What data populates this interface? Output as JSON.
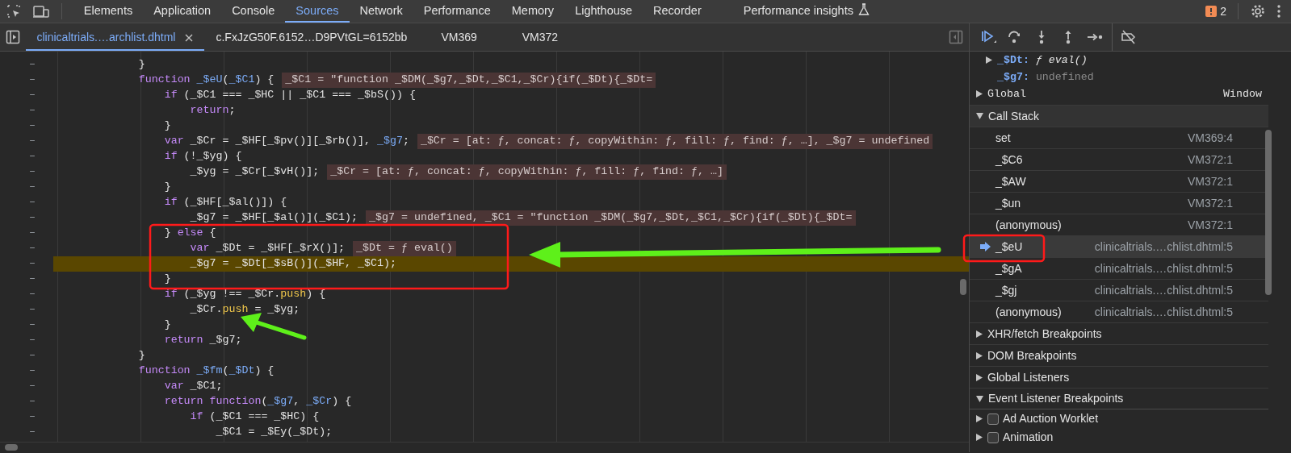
{
  "main_tabs": [
    {
      "label": "Elements",
      "selected": false
    },
    {
      "label": "Application",
      "selected": false
    },
    {
      "label": "Console",
      "selected": false
    },
    {
      "label": "Sources",
      "selected": true
    },
    {
      "label": "Network",
      "selected": false
    },
    {
      "label": "Performance",
      "selected": false
    },
    {
      "label": "Memory",
      "selected": false
    },
    {
      "label": "Lighthouse",
      "selected": false
    },
    {
      "label": "Recorder",
      "selected": false
    },
    {
      "label": "Performance insights",
      "selected": false,
      "experimental": true
    }
  ],
  "issues_count": "2",
  "file_tabs": [
    {
      "label": "clinicaltrials.…archlist.dhtml",
      "selected": true,
      "closable": true
    },
    {
      "label": "c.FxJzG50F.6152…D9PVtGL=6152bb",
      "selected": false,
      "closable": false
    },
    {
      "label": "VM369",
      "selected": false,
      "closable": false
    },
    {
      "label": "VM372",
      "selected": false,
      "closable": false
    }
  ],
  "code_lines": [
    {
      "gutter": "–",
      "paused": false,
      "tokens": [
        {
          "kind": "plain",
          "text": "            }"
        }
      ]
    },
    {
      "gutter": "–",
      "paused": false,
      "tokens": [
        {
          "kind": "keyword",
          "text": "            function "
        },
        {
          "kind": "definition",
          "text": "_$eU"
        },
        {
          "kind": "plain",
          "text": "("
        },
        {
          "kind": "definition",
          "text": "_$C1"
        },
        {
          "kind": "plain",
          "text": ") {"
        }
      ],
      "value": "_$C1 = \"function _$DM(_$g7,_$Dt,_$C1,_$Cr){if(_$Dt){_$Dt="
    },
    {
      "gutter": "–",
      "paused": false,
      "tokens": [
        {
          "kind": "keyword",
          "text": "                if"
        },
        {
          "kind": "plain",
          "text": " (_$C1 === _$HC || _$C1 === _$bS()) {"
        }
      ]
    },
    {
      "gutter": "–",
      "paused": false,
      "tokens": [
        {
          "kind": "keyword",
          "text": "                    return"
        },
        {
          "kind": "plain",
          "text": ";"
        }
      ]
    },
    {
      "gutter": "–",
      "paused": false,
      "tokens": [
        {
          "kind": "plain",
          "text": "                }"
        }
      ]
    },
    {
      "gutter": "–",
      "paused": false,
      "tokens": [
        {
          "kind": "keyword",
          "text": "                var "
        },
        {
          "kind": "plain",
          "text": "_$Cr = _$HF[_$pv()][_$rb()], "
        },
        {
          "kind": "definition",
          "text": "_$g7"
        },
        {
          "kind": "plain",
          "text": ";"
        }
      ],
      "value": "_$Cr = [at: ƒ, concat: ƒ, copyWithin: ƒ, fill: ƒ, find: ƒ, …], _$g7 = undefined"
    },
    {
      "gutter": "–",
      "paused": false,
      "tokens": [
        {
          "kind": "keyword",
          "text": "                if"
        },
        {
          "kind": "plain",
          "text": " (!_$yg) {"
        }
      ]
    },
    {
      "gutter": "–",
      "paused": false,
      "tokens": [
        {
          "kind": "plain",
          "text": "                    _$yg = _$Cr[_$vH()];"
        }
      ],
      "value": "_$Cr = [at: ƒ, concat: ƒ, copyWithin: ƒ, fill: ƒ, find: ƒ, …]"
    },
    {
      "gutter": "–",
      "paused": false,
      "tokens": [
        {
          "kind": "plain",
          "text": "                }"
        }
      ]
    },
    {
      "gutter": "–",
      "paused": false,
      "tokens": [
        {
          "kind": "keyword",
          "text": "                if"
        },
        {
          "kind": "plain",
          "text": " (_$HF[_$al()]) {"
        }
      ]
    },
    {
      "gutter": "–",
      "paused": false,
      "tokens": [
        {
          "kind": "plain",
          "text": "                    _$g7 = _$HF[_$al()](_$C1);"
        }
      ],
      "value": "_$g7 = undefined, _$C1 = \"function _$DM(_$g7,_$Dt,_$C1,_$Cr){if(_$Dt){_$Dt="
    },
    {
      "gutter": "–",
      "paused": false,
      "tokens": [
        {
          "kind": "plain",
          "text": "                } "
        },
        {
          "kind": "keyword",
          "text": "else"
        },
        {
          "kind": "plain",
          "text": " {"
        }
      ]
    },
    {
      "gutter": "–",
      "paused": false,
      "tokens": [
        {
          "kind": "keyword",
          "text": "                    var "
        },
        {
          "kind": "plain",
          "text": "_$Dt = _$HF[_$rX()];"
        }
      ],
      "value": "_$Dt = ƒ eval()"
    },
    {
      "gutter": "–",
      "paused": true,
      "tokens": [
        {
          "kind": "plain",
          "text": "                    _$g7 = _$Dt[_$sB()](_$HF, _$C1);"
        }
      ]
    },
    {
      "gutter": "–",
      "paused": false,
      "tokens": [
        {
          "kind": "plain",
          "text": "                }"
        }
      ]
    },
    {
      "gutter": "–",
      "paused": false,
      "tokens": [
        {
          "kind": "keyword",
          "text": "                if"
        },
        {
          "kind": "plain",
          "text": " (_$yg !== _$Cr."
        },
        {
          "kind": "property",
          "text": "push"
        },
        {
          "kind": "plain",
          "text": ") {"
        }
      ]
    },
    {
      "gutter": "–",
      "paused": false,
      "tokens": [
        {
          "kind": "plain",
          "text": "                    _$Cr."
        },
        {
          "kind": "property",
          "text": "push"
        },
        {
          "kind": "plain",
          "text": " = _$yg;"
        }
      ]
    },
    {
      "gutter": "–",
      "paused": false,
      "tokens": [
        {
          "kind": "plain",
          "text": "                }"
        }
      ]
    },
    {
      "gutter": "–",
      "paused": false,
      "tokens": [
        {
          "kind": "keyword",
          "text": "                return"
        },
        {
          "kind": "plain",
          "text": " _$g7;"
        }
      ]
    },
    {
      "gutter": "–",
      "paused": false,
      "tokens": [
        {
          "kind": "plain",
          "text": "            }"
        }
      ]
    },
    {
      "gutter": "–",
      "paused": false,
      "tokens": [
        {
          "kind": "keyword",
          "text": "            function "
        },
        {
          "kind": "definition",
          "text": "_$fm"
        },
        {
          "kind": "plain",
          "text": "("
        },
        {
          "kind": "definition",
          "text": "_$Dt"
        },
        {
          "kind": "plain",
          "text": ") {"
        }
      ]
    },
    {
      "gutter": "–",
      "paused": false,
      "tokens": [
        {
          "kind": "keyword",
          "text": "                var "
        },
        {
          "kind": "plain",
          "text": "_$C1;"
        }
      ]
    },
    {
      "gutter": "–",
      "paused": false,
      "tokens": [
        {
          "kind": "keyword",
          "text": "                return function"
        },
        {
          "kind": "plain",
          "text": "("
        },
        {
          "kind": "definition",
          "text": "_$g7"
        },
        {
          "kind": "plain",
          "text": ", "
        },
        {
          "kind": "definition",
          "text": "_$Cr"
        },
        {
          "kind": "plain",
          "text": ") {"
        }
      ]
    },
    {
      "gutter": "–",
      "paused": false,
      "tokens": [
        {
          "kind": "keyword",
          "text": "                    if"
        },
        {
          "kind": "plain",
          "text": " (_$C1 === _$HC) {"
        }
      ]
    },
    {
      "gutter": "–",
      "paused": false,
      "tokens": [
        {
          "kind": "plain",
          "text": "                        _$C1 = _$Ey(_$Dt);"
        }
      ]
    }
  ],
  "scope_vars": [
    {
      "name": "_$Dt:",
      "value": "ƒ eval()",
      "kind": "function",
      "expandable": true
    },
    {
      "name": "_$g7:",
      "value": "undefined",
      "kind": "undefined",
      "expandable": false
    }
  ],
  "global_scope": {
    "label": "Global",
    "value": "Window",
    "expanded": false
  },
  "call_stack": {
    "label": "Call Stack",
    "expanded": true,
    "frames": [
      {
        "name": "set",
        "location": "VM369:4",
        "selected": false
      },
      {
        "name": "_$C6",
        "location": "VM372:1",
        "selected": false
      },
      {
        "name": "_$AW",
        "location": "VM372:1",
        "selected": false
      },
      {
        "name": "_$un",
        "location": "VM372:1",
        "selected": false
      },
      {
        "name": "(anonymous)",
        "location": "VM372:1",
        "selected": false
      },
      {
        "name": "_$eU",
        "location": "clinicaltrials.…chlist.dhtml:5",
        "selected": true
      },
      {
        "name": "_$gA",
        "location": "clinicaltrials.…chlist.dhtml:5",
        "selected": false
      },
      {
        "name": "_$gj",
        "location": "clinicaltrials.…chlist.dhtml:5",
        "selected": false
      },
      {
        "name": "(anonymous)",
        "location": "clinicaltrials.…chlist.dhtml:5",
        "selected": false
      }
    ]
  },
  "sections": [
    {
      "label": "XHR/fetch Breakpoints",
      "expanded": false
    },
    {
      "label": "DOM Breakpoints",
      "expanded": false
    },
    {
      "label": "Global Listeners",
      "expanded": false
    },
    {
      "label": "Event Listener Breakpoints",
      "expanded": true,
      "items": [
        {
          "label": "Ad Auction Worklet",
          "checked": false
        },
        {
          "label": "Animation",
          "checked": false
        }
      ]
    }
  ]
}
